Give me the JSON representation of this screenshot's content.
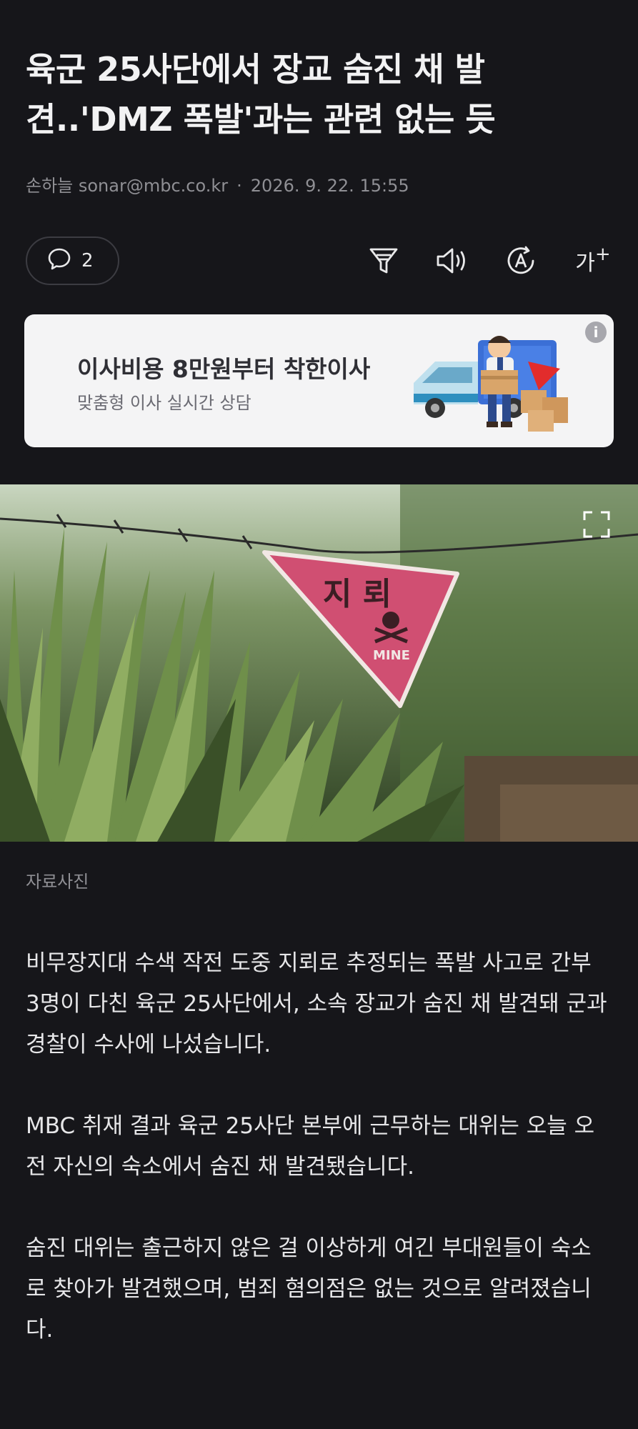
{
  "article": {
    "title": "육군 25사단에서 장교 숨진 채 발견..'DMZ 폭발'과는 관련 없는 듯",
    "author": "손하늘 sonar@mbc.co.kr",
    "separator": "·",
    "date": "2026. 9. 22. 15:55"
  },
  "toolbar": {
    "comment_count": "2",
    "icons": [
      "comment-icon",
      "filter-icon",
      "speaker-icon",
      "translate-icon",
      "font-size-icon"
    ],
    "font_size_label": "가"
  },
  "ad": {
    "title": "이사비용 8만원부터 착한이사",
    "subtitle": "맞춤형 이사 실시간 상담",
    "info_label": "i"
  },
  "photo": {
    "sign_top": "지 뢰",
    "sign_bottom": "MINE",
    "caption": "자료사진"
  },
  "body": {
    "paragraphs": [
      "비무장지대 수색 작전 도중 지뢰로 추정되는 폭발 사고로 간부 3명이 다친 육군 25사단에서, 소속 장교가 숨진 채 발견돼 군과 경찰이 수사에 나섰습니다.",
      "MBC 취재 결과 육군 25사단 본부에 근무하는 대위는 오늘 오전 자신의 숙소에서 숨진 채 발견됐습니다.",
      "숨진 대위는 출근하지 않은 걸 이상하게 여긴 부대원들이 숙소로 찾아가 발견했으며, 범죄 혐의점은 없는 것으로 알려졌습니다."
    ]
  }
}
